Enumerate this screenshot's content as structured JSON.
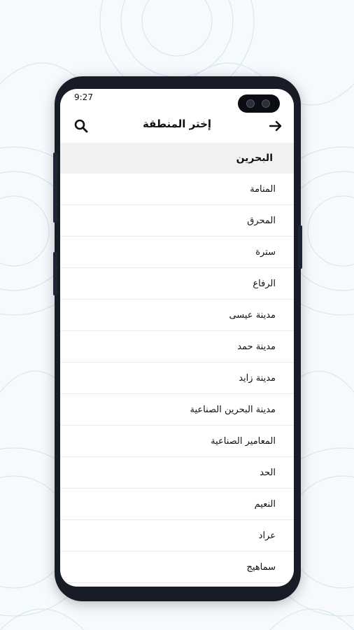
{
  "status_bar": {
    "time": "9:27"
  },
  "header": {
    "title": "إختر المنطقة"
  },
  "icons": {
    "back": "arrow-right-icon",
    "search": "search-icon"
  },
  "list": {
    "group_label": "البحرين",
    "items": [
      "المنامة",
      "المحرق",
      "سترة",
      "الرفاع",
      "مدينة عيسى",
      "مدينة حمد",
      "مدينة زايد",
      "مدينة البحرين الصناعية",
      "المعامير الصناعية",
      "الحد",
      "النعيم",
      "عراد",
      "سماهيج"
    ]
  },
  "colors": {
    "frame": "#171c27",
    "background": "#f6fafd",
    "group_bg": "#f1f1f1"
  }
}
